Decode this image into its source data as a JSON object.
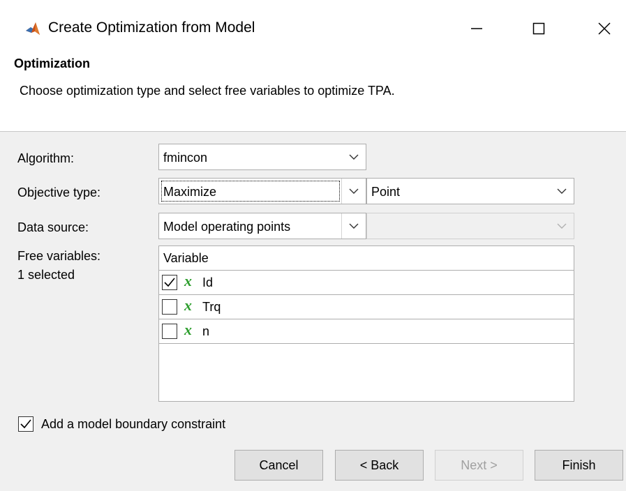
{
  "window": {
    "title": "Create Optimization from Model",
    "minimize_icon": "minimize-icon",
    "maximize_icon": "maximize-icon",
    "close_icon": "close-icon"
  },
  "header": {
    "section_title": "Optimization",
    "description": "Choose optimization type and select free variables to optimize TPA."
  },
  "form": {
    "algorithm_label": "Algorithm:",
    "algorithm_value": "fmincon",
    "objective_label": "Objective type:",
    "objective_value": "Maximize",
    "objective_scope": "Point",
    "data_source_label": "Data source:",
    "data_source_value": "Model operating points",
    "data_source_secondary": "",
    "free_variables_label": "Free variables:",
    "free_variables_count": "1 selected"
  },
  "variables_table": {
    "header": "Variable",
    "rows": [
      {
        "name": "Id",
        "checked": true
      },
      {
        "name": "Trq",
        "checked": false
      },
      {
        "name": "n",
        "checked": false
      }
    ]
  },
  "boundary": {
    "label": "Add a model boundary constraint",
    "checked": true
  },
  "buttons": {
    "cancel": "Cancel",
    "back": "< Back",
    "next": "Next >",
    "finish": "Finish"
  }
}
